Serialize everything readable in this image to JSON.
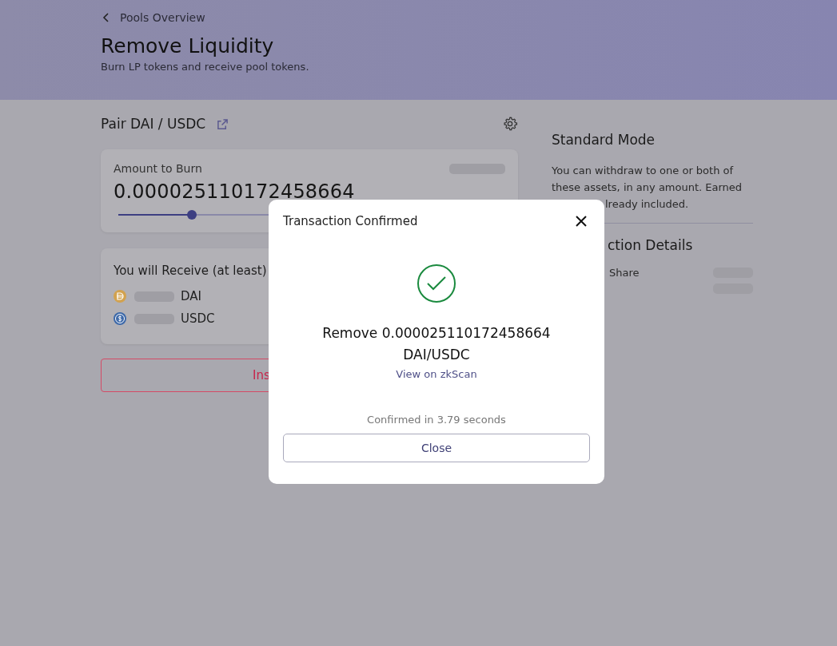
{
  "header": {
    "back_link": "Pools Overview",
    "title": "Remove Liquidity",
    "subtitle": "Burn LP tokens and receive pool tokens."
  },
  "pair": {
    "title": "Pair DAI / USDC"
  },
  "burn_card": {
    "label": "Amount to Burn",
    "amount": "0.000025110172458664",
    "slider": {
      "level": 0.19
    }
  },
  "receive_card": {
    "title": "You will Receive (at least)",
    "tokens": [
      {
        "kind": "dai",
        "symbol": "DAI"
      },
      {
        "kind": "usdc",
        "symbol": "USDC"
      }
    ]
  },
  "action_button": {
    "label": "Ins"
  },
  "info": {
    "title": "Standard Mode",
    "text_lines": [
      "You can withdraw to one or both of",
      "these assets, in any amount. Earned",
      "lready included."
    ],
    "details_title": "ction Details",
    "details_rows": [
      {
        "label": "Share"
      }
    ]
  },
  "modal": {
    "title": "Transaction Confirmed",
    "message_lines": [
      "Remove 0.000025110172458664",
      "DAI/USDC"
    ],
    "link": "View on zkScan",
    "confirmed_text": "Confirmed in 3.79 seconds",
    "close_button": "Close"
  }
}
